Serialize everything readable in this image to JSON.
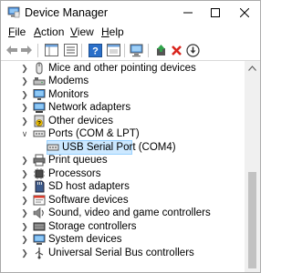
{
  "window": {
    "title": "Device Manager"
  },
  "menu": [
    {
      "first": "F",
      "rest": "ile"
    },
    {
      "first": "A",
      "rest": "ction"
    },
    {
      "first": "V",
      "rest": "iew"
    },
    {
      "first": "H",
      "rest": "elp"
    }
  ],
  "tree": {
    "items": [
      {
        "label": "Mice and other pointing devices",
        "icon": "mouse-icon",
        "expanded": false
      },
      {
        "label": "Modems",
        "icon": "modem-icon",
        "expanded": false
      },
      {
        "label": "Monitors",
        "icon": "monitor-icon",
        "expanded": false
      },
      {
        "label": "Network adapters",
        "icon": "network-adapter-icon",
        "expanded": false
      },
      {
        "label": "Other devices",
        "icon": "other-devices-icon",
        "expanded": false
      },
      {
        "label": "Ports (COM & LPT)",
        "icon": "ports-icon",
        "expanded": true
      },
      {
        "label": "USB Serial Port (COM4)",
        "icon": "port-device-icon",
        "child": true,
        "selected": true
      },
      {
        "label": "Print queues",
        "icon": "printer-icon",
        "expanded": false
      },
      {
        "label": "Processors",
        "icon": "processor-icon",
        "expanded": false
      },
      {
        "label": "SD host adapters",
        "icon": "sd-card-icon",
        "expanded": false
      },
      {
        "label": "Software devices",
        "icon": "software-devices-icon",
        "expanded": false
      },
      {
        "label": "Sound, video and game controllers",
        "icon": "speaker-icon",
        "expanded": false
      },
      {
        "label": "Storage controllers",
        "icon": "storage-controller-icon",
        "expanded": false
      },
      {
        "label": "System devices",
        "icon": "system-devices-icon",
        "expanded": false
      },
      {
        "label": "Universal Serial Bus controllers",
        "icon": "usb-icon",
        "expanded": false
      }
    ]
  },
  "colors": {
    "selection_bg": "#cce8ff",
    "selection_border": "#99d1ff"
  }
}
